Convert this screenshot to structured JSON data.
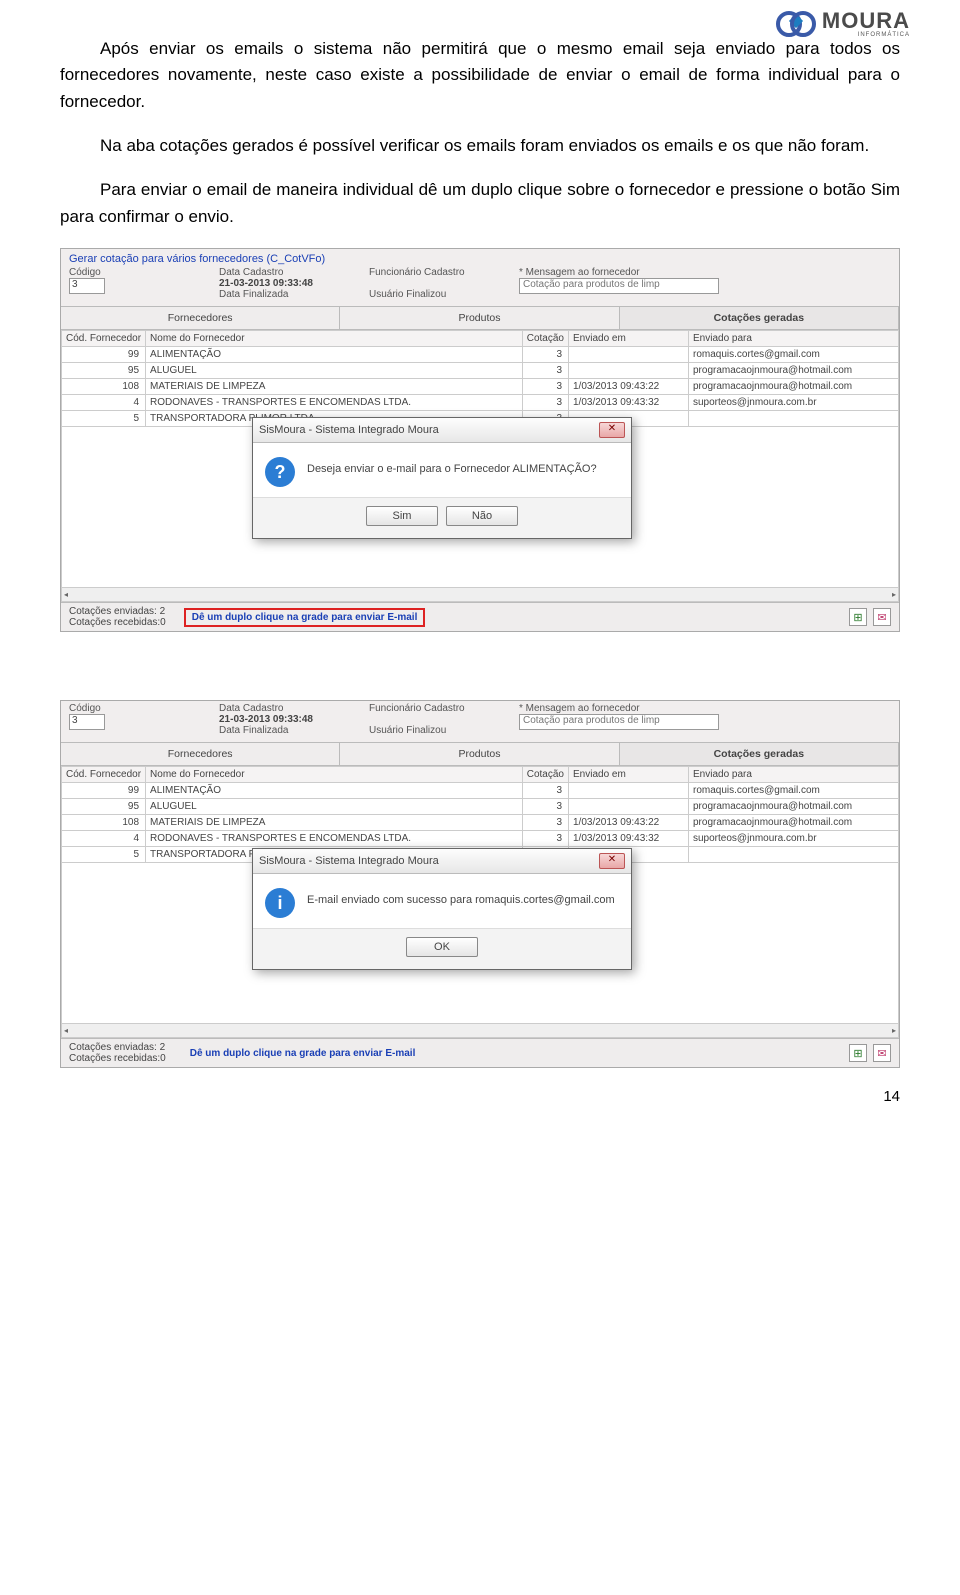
{
  "logo": {
    "brand": "MOURA",
    "sub": "INFORMÁTICA"
  },
  "paragraphs": {
    "p1": "Após enviar os emails o sistema não permitirá que o mesmo email seja enviado para todos os fornecedores novamente, neste caso existe a possibilidade de enviar o email de forma individual para o fornecedor.",
    "p2": "Na aba cotações gerados é possível verificar os emails foram enviados os emails e os que não foram.",
    "p3": "Para enviar o email de maneira individual dê um duplo clique sobre o fornecedor e pressione o botão Sim para confirmar o envio."
  },
  "group_title": "Gerar cotação para vários fornecedores (C_CotVFo)",
  "header": {
    "codigo_label": "Código",
    "codigo_value": "3",
    "data_cad_label": "Data Cadastro",
    "data_cad_value": "21-03-2013 09:33:48",
    "data_fin_label": "Data Finalizada",
    "data_fin_value": "",
    "func_label": "Funcionário Cadastro",
    "func_value": "",
    "user_label": "Usuário Finalizou",
    "user_value": "",
    "msg_label": "* Mensagem ao fornecedor",
    "msg_value": "Cotação para produtos de limp"
  },
  "tabs": {
    "t1": "Fornecedores",
    "t2": "Produtos",
    "t3": "Cotações geradas"
  },
  "columns": {
    "c1": "Cód. Fornecedor",
    "c2": "Nome do Fornecedor",
    "c3": "Cotação",
    "c4": "Enviado em",
    "c5": "Enviado para"
  },
  "rows": [
    {
      "cod": "99",
      "nome": "ALIMENTAÇÃO",
      "cot": "3",
      "env": "",
      "para": "romaquis.cortes@gmail.com"
    },
    {
      "cod": "95",
      "nome": "ALUGUEL",
      "cot": "3",
      "env": "",
      "para": "programacaojnmoura@hotmail.com"
    },
    {
      "cod": "108",
      "nome": "MATERIAIS DE LIMPEZA",
      "cot": "3",
      "env": "1/03/2013 09:43:22",
      "para": "programacaojnmoura@hotmail.com"
    },
    {
      "cod": "4",
      "nome": "RODONAVES - TRANSPORTES E ENCOMENDAS LTDA.",
      "cot": "3",
      "env": "1/03/2013 09:43:32",
      "para": "suporteos@jnmoura.com.br"
    },
    {
      "cod": "5",
      "nome": "TRANSPORTADORA PLIMOR LTDA.",
      "cot": "3",
      "env": "",
      "para": ""
    }
  ],
  "footer": {
    "env_label": "Cotações enviadas:",
    "env_val": "2",
    "rec_label": "Cotações recebidas:",
    "rec_val": "0",
    "hint": "Dê um duplo clique na grade para enviar E-mail"
  },
  "dialog1": {
    "title": "SisMoura - Sistema Integrado Moura",
    "msg": "Deseja enviar o e-mail para o Fornecedor ALIMENTAÇÃO?",
    "yes": "Sim",
    "no": "Não"
  },
  "dialog2": {
    "title": "SisMoura - Sistema Integrado Moura",
    "msg": "E-mail enviado com sucesso para romaquis.cortes@gmail.com",
    "ok": "OK"
  },
  "page_number": "14"
}
